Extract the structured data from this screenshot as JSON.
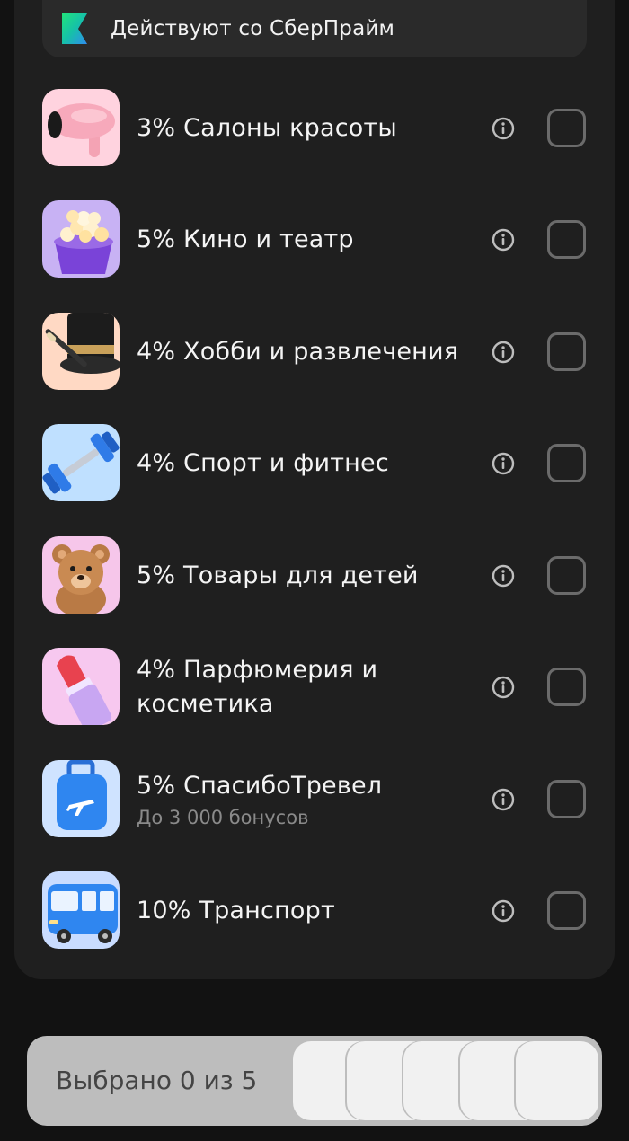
{
  "prime_banner": {
    "text": "Действуют со СберПрайм"
  },
  "categories": [
    {
      "label": "3% Салоны красоты",
      "icon": "hair-dryer"
    },
    {
      "label": "5% Кино и театр",
      "icon": "popcorn"
    },
    {
      "label": "4% Хобби и развлечения",
      "icon": "magic-hat"
    },
    {
      "label": "4% Спорт и фитнес",
      "icon": "dumbbell"
    },
    {
      "label": "5% Товары для детей",
      "icon": "teddy-bear"
    },
    {
      "label_line1": "4% Парфюмерия и",
      "label_line2": "косметика",
      "icon": "lipstick"
    },
    {
      "label": "5% СпасибоТревел",
      "sublabel": "До 3 000 бонусов",
      "icon": "suitcase"
    },
    {
      "label": "10% Транспорт",
      "icon": "bus"
    }
  ],
  "bottom_bar": {
    "label": "Выбрано 0 из 5",
    "selected": 0,
    "max": 5
  },
  "colors": {
    "background": "#121212",
    "card": "#1f1f1f",
    "checkbox_border": "#6b6b6b",
    "bottom_bar": "#bdbdbd"
  }
}
